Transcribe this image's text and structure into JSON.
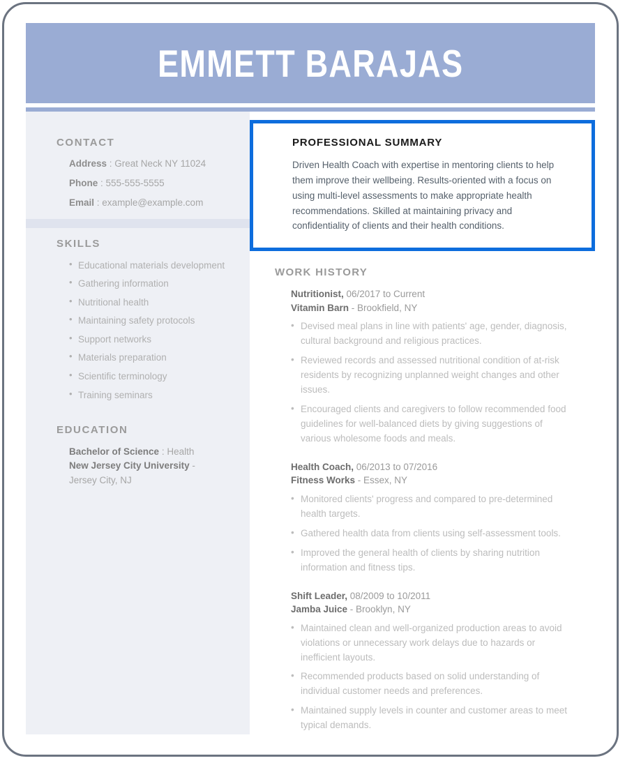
{
  "document": {
    "name": "EMMETT BARAJAS",
    "accent_header_color": "#9aacd4",
    "sidebar_color": "#eef0f5",
    "highlight_border_color": "#0d6ddd",
    "frame_color": "#6b7380"
  },
  "sidebar": {
    "contact": {
      "heading": "CONTACT",
      "items": [
        {
          "label": "Address",
          "sep": " : ",
          "value": "Great Neck NY 11024"
        },
        {
          "label": "Phone",
          "sep": " : ",
          "value": "555-555-5555"
        },
        {
          "label": "Email",
          "sep": " : ",
          "value": "example@example.com"
        }
      ]
    },
    "skills": {
      "heading": "SKILLS",
      "items": [
        "Educational materials development",
        "Gathering information",
        "Nutritional health",
        "Maintaining safety protocols",
        "Support networks",
        "Materials preparation",
        "Scientific terminology",
        "Training seminars"
      ]
    },
    "education": {
      "heading": "EDUCATION",
      "degree_label": "Bachelor of Science",
      "degree_sep": " : ",
      "degree_field": "Health",
      "school": "New Jersey City University",
      "school_sep": " - ",
      "location": "Jersey City, NJ"
    }
  },
  "main": {
    "summary": {
      "heading": "PROFESSIONAL SUMMARY",
      "text": "Driven Health Coach with expertise in mentoring clients to help them improve their wellbeing. Results-oriented with a focus on using multi-level assessments to make appropriate health recommendations. Skilled at maintaining privacy and confidentiality of clients and their health conditions."
    },
    "work_history": {
      "heading": "WORK HISTORY",
      "jobs": [
        {
          "title": "Nutritionist,",
          "dates": " 06/2017 to Current",
          "company": "Vitamin Barn",
          "company_sep": " - ",
          "location": "Brookfield, NY",
          "bullets": [
            "Devised meal plans in line with patients' age, gender, diagnosis, cultural background and religious practices.",
            "Reviewed records and assessed nutritional condition of at-risk residents by recognizing unplanned weight changes and other issues.",
            "Encouraged clients and caregivers to follow recommended food guidelines for well-balanced diets by giving suggestions of various wholesome foods and meals."
          ]
        },
        {
          "title": "Health Coach,",
          "dates": " 06/2013 to 07/2016",
          "company": "Fitness Works",
          "company_sep": " - ",
          "location": "Essex, NY",
          "bullets": [
            "Monitored clients' progress and compared to pre-determined health targets.",
            "Gathered health data from clients using self-assessment tools.",
            "Improved the general health of clients by sharing nutrition information and fitness tips."
          ]
        },
        {
          "title": "Shift Leader,",
          "dates": " 08/2009 to 10/2011",
          "company": "Jamba Juice",
          "company_sep": " - ",
          "location": "Brooklyn, NY",
          "bullets": [
            "Maintained clean and well-organized production areas to avoid violations or unnecessary work delays due to hazards or inefficient layouts.",
            "Recommended products based on solid understanding of individual customer needs and preferences.",
            "Maintained supply levels in counter and customer areas to meet typical demands."
          ]
        }
      ]
    }
  }
}
